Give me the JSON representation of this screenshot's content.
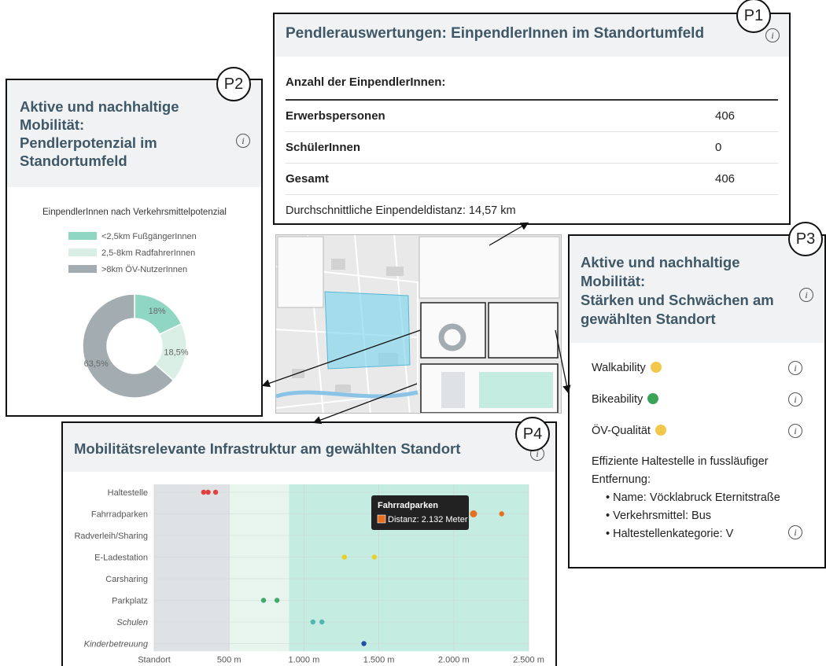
{
  "p1": {
    "badge": "P1",
    "title": "Pendlerauswertungen: EinpendlerInnen im Standortumfeld",
    "table_header": "Anzahl der EinpendlerInnen:",
    "rows": [
      {
        "label": "Erwerbspersonen",
        "value": "406"
      },
      {
        "label": "SchülerInnen",
        "value": "0"
      },
      {
        "label": "Gesamt",
        "value": "406"
      }
    ],
    "footer": "Durchschnittliche Einpendeldistanz: 14,57 km"
  },
  "p2": {
    "badge": "P2",
    "title_lines": [
      "Aktive und nachhaltige",
      "Mobilität:",
      "Pendlerpotenzial im",
      "Standortumfeld"
    ],
    "chart_title": "EinpendlerInnen nach Verkehrsmittelpotenzial"
  },
  "p3": {
    "badge": "P3",
    "title_lines": [
      "Aktive und nachhaltige",
      "Mobilität:",
      "Stärken und Schwächen am",
      "gewählten Standort"
    ],
    "items": [
      {
        "label": "Walkability",
        "status_color": "#f2c84b"
      },
      {
        "label": "Bikeability",
        "status_color": "#3aa357"
      },
      {
        "label": "ÖV-Qualität",
        "status_color": "#f2c84b"
      }
    ],
    "stop_heading_1": "Effiziente Haltestelle in fussläufiger",
    "stop_heading_2": "Entfernung:",
    "bullets": [
      "Name: Vöcklabruck Eternitstraße",
      "Verkehrsmittel: Bus",
      "Haltestellenkategorie: V"
    ]
  },
  "p4": {
    "badge": "P4",
    "title": "Mobilitätsrelevante Infrastruktur am gewählten Standort",
    "tooltip": {
      "title": "Fahrradparken",
      "text": "Distanz: 2.132 Meter",
      "color": "#e6701f"
    }
  },
  "chart_data": [
    {
      "type": "pie",
      "title": "EinpendlerInnen nach Verkehrsmittelpotenzial",
      "legend": "top",
      "categories": [
        "<2,5km FußgängerInnen",
        "2,5-8km RadfahrerInnen",
        ">8km ÖV-NutzerInnen"
      ],
      "values": [
        18,
        18.5,
        63.5
      ],
      "value_labels": [
        "18%",
        "18,5%",
        "63,5%"
      ],
      "colors": [
        "#8fd6c3",
        "#d9efe6",
        "#a3acb1"
      ]
    },
    {
      "type": "scatter",
      "categories": [
        "Haltestelle",
        "Fahrradparken",
        "Radverleih/Sharing",
        "E-Ladestation",
        "Carsharing",
        "Parkplatz",
        "Schulen",
        "Kinderbetreuung"
      ],
      "italic_categories": [
        "Schulen",
        "Kinderbetreuung"
      ],
      "x_ticks": [
        {
          "v": 0,
          "t": "Standort"
        },
        {
          "v": 500,
          "t": "500 m"
        },
        {
          "v": 1000,
          "t": "1.000 m"
        },
        {
          "v": 1500,
          "t": "1.500 m"
        },
        {
          "v": 2000,
          "t": "2.000 m"
        },
        {
          "v": 2500,
          "t": "2.500 m"
        }
      ],
      "xlim": [
        0,
        2500
      ],
      "bands": [
        {
          "from": 0,
          "to": 500,
          "color": "#dfe2e4"
        },
        {
          "from": 500,
          "to": 900,
          "color": "#e8f5ee"
        },
        {
          "from": 900,
          "to": 2500,
          "color": "#c4ece0"
        }
      ],
      "series": [
        {
          "category": "Haltestelle",
          "color": "#e04040",
          "x": [
            330,
            360,
            410
          ]
        },
        {
          "category": "Fahrradparken",
          "color": "#e6701f",
          "x": [
            2132,
            2320
          ]
        },
        {
          "category": "E-Ladestation",
          "color": "#e8d02a",
          "x": [
            1270,
            1470
          ]
        },
        {
          "category": "Parkplatz",
          "color": "#3ea96a",
          "x": [
            730,
            820
          ]
        },
        {
          "category": "Schulen",
          "color": "#4fb7b0",
          "x": [
            1060,
            1120
          ]
        },
        {
          "category": "Kinderbetreuung",
          "color": "#2250a8",
          "x": [
            1400
          ]
        }
      ]
    }
  ]
}
